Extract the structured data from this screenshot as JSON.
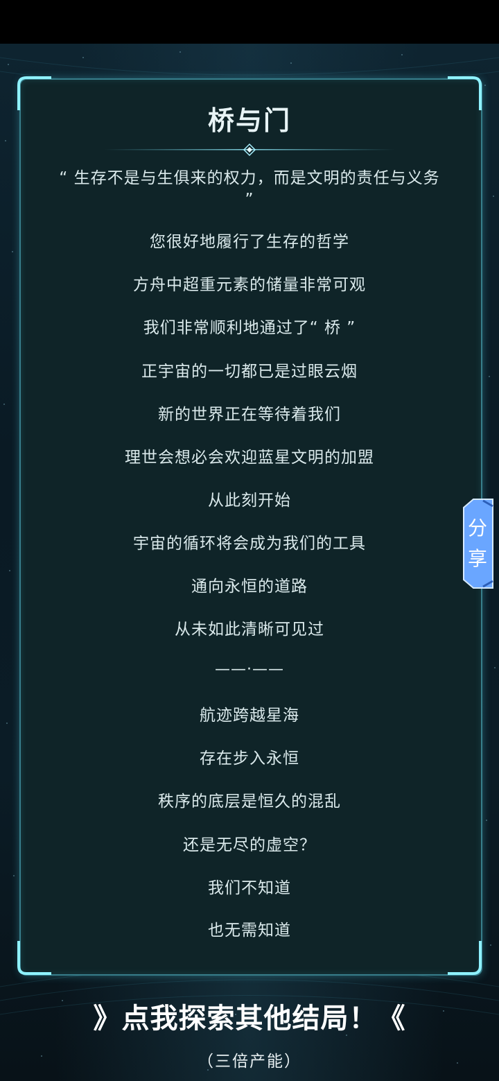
{
  "ending": {
    "title": "桥与门",
    "quote": "“ 生存不是与生俱来的权力，而是文明的责任与义务 ”",
    "lines_a": [
      "您很好地履行了生存的哲学",
      "方舟中超重元素的储量非常可观",
      "我们非常顺利地通过了“ 桥 ”",
      "正宇宙的一切都已是过眼云烟",
      "新的世界正在等待着我们",
      "理世会想必会欢迎蓝星文明的加盟",
      "从此刻开始",
      "宇宙的循环将会成为我们的工具",
      "通向永恒的道路",
      "从未如此清晰可见过"
    ],
    "separator": "——·——",
    "lines_b": [
      "航迹跨越星海",
      "存在步入永恒",
      "秩序的底层是恒久的混乱",
      "还是无尽的虚空？",
      "我们不知道",
      "也无需知道"
    ]
  },
  "share": {
    "label_1": "分",
    "label_2": "享"
  },
  "explore": {
    "label": "》点我探索其他结局！《",
    "sublabel": "（三倍产能）"
  },
  "colors": {
    "panel_border": "#5ac8dc",
    "share_tab": "#6aa6ff",
    "text": "#dbeaec"
  }
}
